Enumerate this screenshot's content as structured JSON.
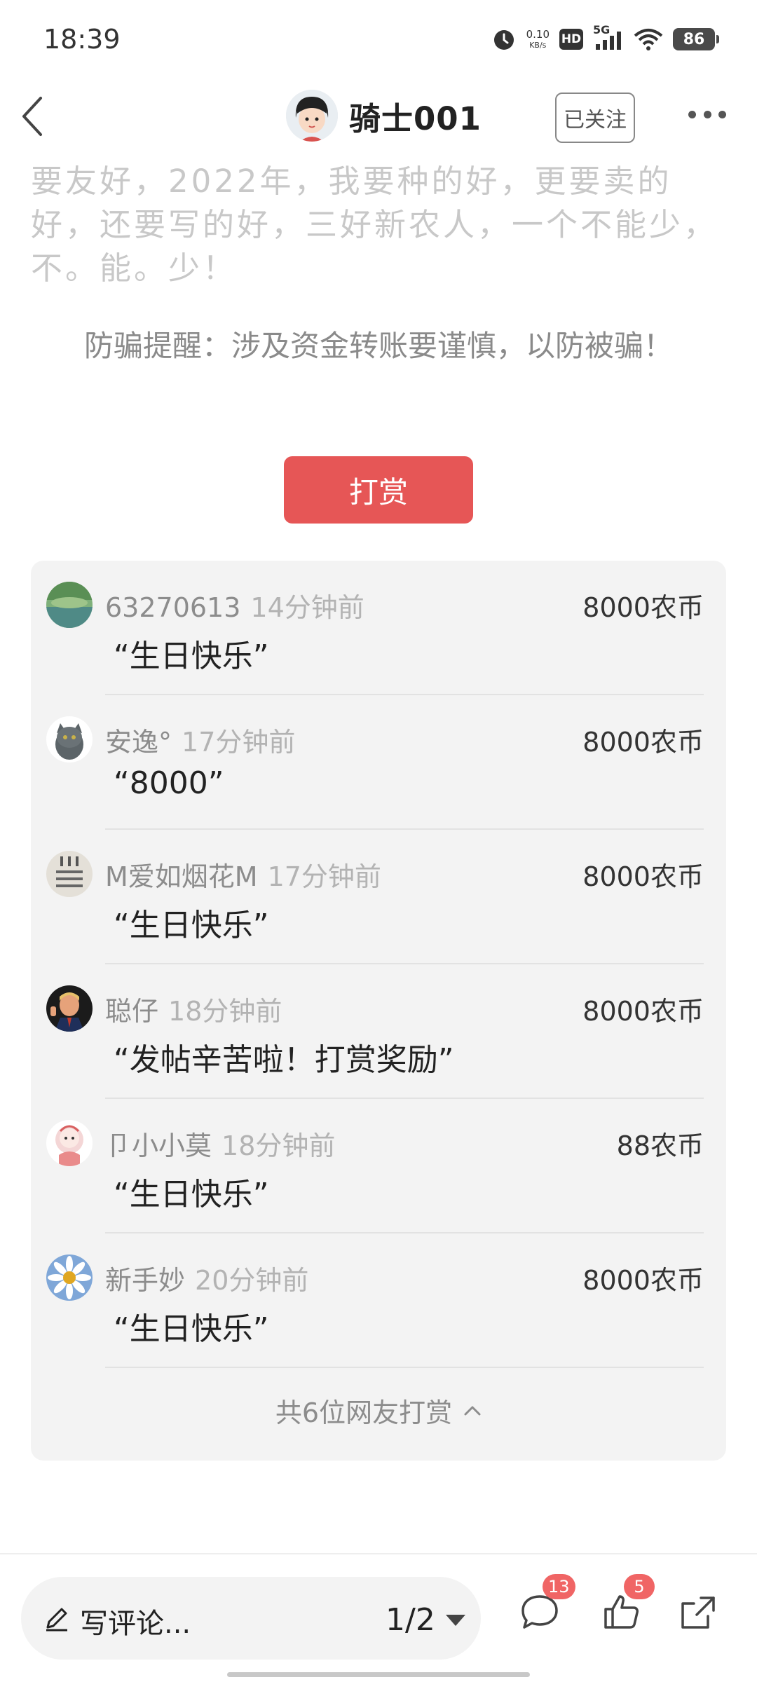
{
  "status_bar": {
    "time": "18:39",
    "net_speed_value": "0.10",
    "net_speed_unit": "KB/s",
    "hd_label": "HD",
    "network_label": "5G",
    "battery": "86"
  },
  "header": {
    "author_name": "骑士001",
    "follow_label": "已关注"
  },
  "post": {
    "text": "要友好，2022年，我要种的好，更要卖的好，还要写的好，三好新农人，一个不能少，不。能。少！"
  },
  "fraud_warning": "防骗提醒：涉及资金转账要谨慎，以防被骗！",
  "reward_button": "打赏",
  "rewards": [
    {
      "user": "63270613",
      "time": "14分钟前",
      "amount": "8000农币",
      "message": "“生日快乐”"
    },
    {
      "user": "安逸°",
      "time": "17分钟前",
      "amount": "8000农币",
      "message": "“8000”"
    },
    {
      "user": "M爱如烟花M",
      "time": "17分钟前",
      "amount": "8000农币",
      "message": "“生日快乐”"
    },
    {
      "user": "聪仔",
      "time": "18分钟前",
      "amount": "8000农币",
      "message": "“发帖辛苦啦！打赏奖励”"
    },
    {
      "user": "卩小小莫",
      "time": "18分钟前",
      "amount": "88农币",
      "message": "“生日快乐”"
    },
    {
      "user": "新手妙",
      "time": "20分钟前",
      "amount": "8000农币",
      "message": "“生日快乐”"
    }
  ],
  "reward_summary": "共6位网友打赏",
  "bottom_bar": {
    "comment_placeholder": "写评论...",
    "page_indicator": "1/2",
    "comment_count": "13",
    "like_count": "5"
  },
  "colors": {
    "accent_red": "#e65656",
    "badge_red": "#f06565",
    "panel_bg": "#f3f3f3"
  }
}
